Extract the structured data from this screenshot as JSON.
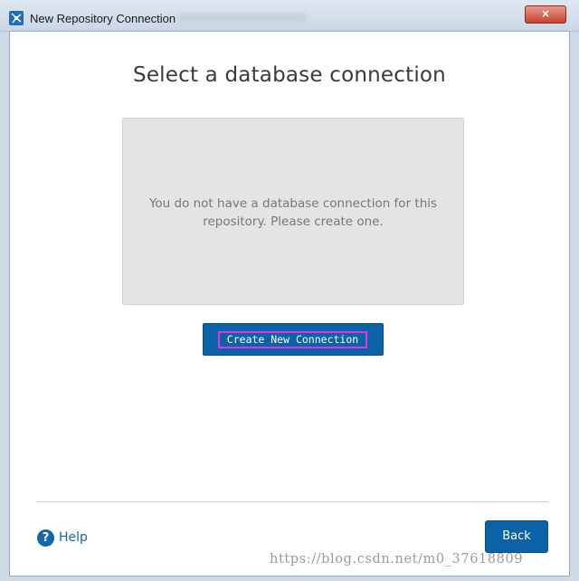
{
  "window": {
    "title": "New Repository Connection",
    "close_glyph": "×",
    "icon": "app-icon"
  },
  "main": {
    "heading": "Select a database connection",
    "empty_message": "You do not have a database connection for this repository. Please create one.",
    "create_button_label": "Create New Connection"
  },
  "footer": {
    "help_label": "Help",
    "help_icon_glyph": "?",
    "back_label": "Back"
  },
  "watermark": "https://blog.csdn.net/m0_37618809",
  "colors": {
    "accent": "#0b62a6",
    "highlight": "#e034e6"
  }
}
